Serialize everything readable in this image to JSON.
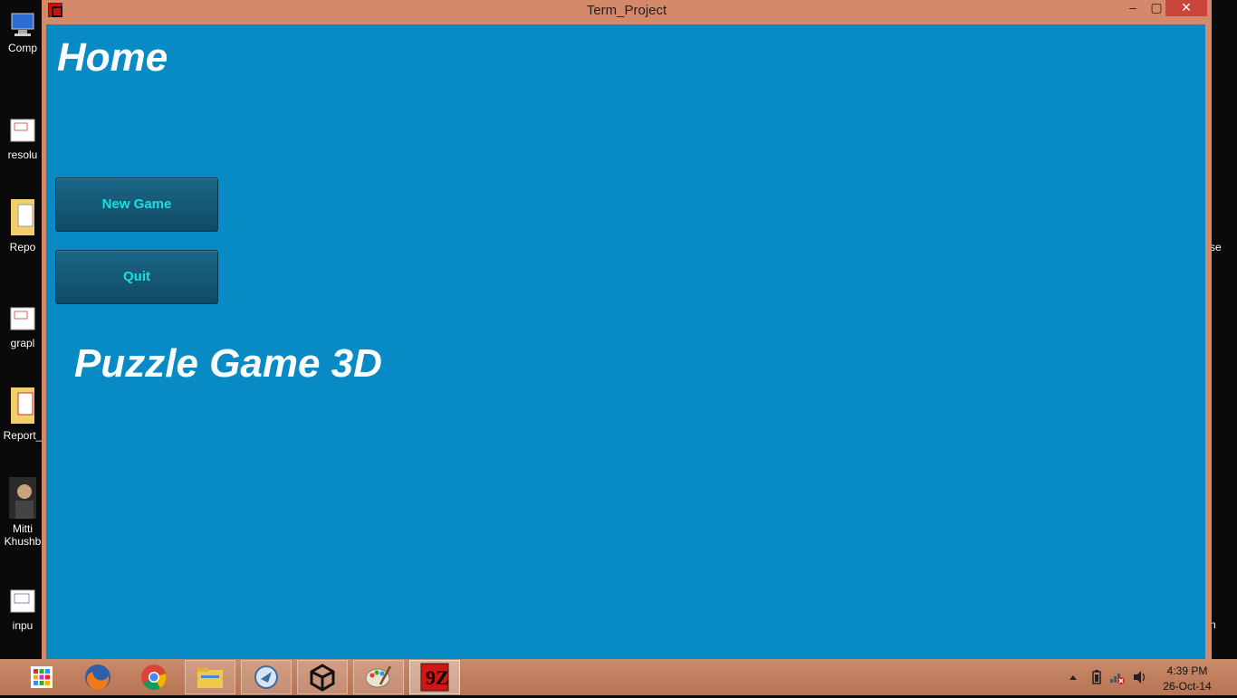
{
  "window": {
    "title": "Term_Project",
    "controls": {
      "minimize": "–",
      "maximize": "▢",
      "close": "✕"
    }
  },
  "app": {
    "heading": "Home",
    "buttons": {
      "new_game": "New Game",
      "quit": "Quit"
    },
    "game_title": "Puzzle Game 3D",
    "colors": {
      "background": "#088ac5",
      "button": "#135b7a",
      "button_text": "#18e0e0"
    }
  },
  "desktop": {
    "icons": [
      {
        "label": "Comp",
        "icon": "computer-icon"
      },
      {
        "label": "resolu",
        "icon": "document-icon"
      },
      {
        "label": "Repo",
        "icon": "folder-icon"
      },
      {
        "label": "grapl",
        "icon": "document-icon"
      },
      {
        "label": "Report_",
        "icon": "folder-icon"
      },
      {
        "label": "Mitti",
        "label2": "Khushb",
        "icon": "photo-icon"
      },
      {
        "label": "inpu",
        "icon": "document-icon"
      }
    ],
    "right_fragments": {
      "top": "se",
      "bottom": "n"
    }
  },
  "taskbar": {
    "items": [
      "apps-icon",
      "firefox-icon",
      "chrome-icon",
      "file-explorer-icon",
      "rdp-icon",
      "unity-icon",
      "paint-icon",
      "term-project-icon"
    ],
    "clock": {
      "time": "4:39 PM",
      "date": "26-Oct-14"
    }
  }
}
